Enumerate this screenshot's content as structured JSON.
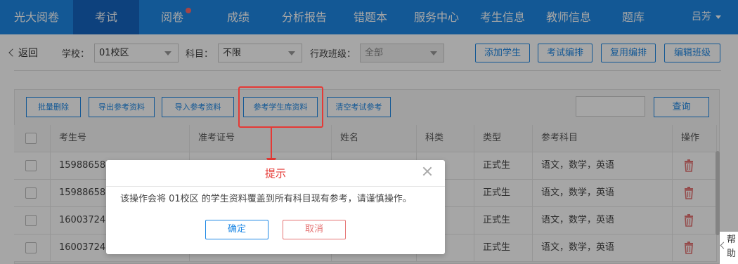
{
  "nav": {
    "brand": "光大阅卷",
    "items": [
      {
        "label": "考试"
      },
      {
        "label": "阅卷"
      },
      {
        "label": "成绩"
      },
      {
        "label": "分析报告"
      },
      {
        "label": "错题本"
      },
      {
        "label": "服务中心"
      },
      {
        "label": "考生信息"
      },
      {
        "label": "教师信息"
      },
      {
        "label": "题库"
      }
    ],
    "user": "吕芳"
  },
  "filters": {
    "back": "返回",
    "school_label": "学校：",
    "school_value": "01校区",
    "subject_label": "科目：",
    "subject_value": "不限",
    "class_label": "行政班级：",
    "class_value": "全部",
    "buttons": [
      "添加学生",
      "考试编排",
      "复用编排",
      "编辑班级"
    ]
  },
  "toolbar": {
    "buttons": [
      "批量删除",
      "导出参考资料",
      "导入参考资料",
      "参考学生库资料",
      "清空考试参考"
    ],
    "search_button": "查询"
  },
  "table": {
    "headers": [
      "考生号",
      "准考证号",
      "姓名",
      "科类",
      "类型",
      "参考科目",
      "操作"
    ],
    "rows": [
      {
        "id": "15988658",
        "type": "正式生",
        "subjects": "语文，数学，英语"
      },
      {
        "id": "15988658",
        "type": "正式生",
        "subjects": "语文，数学，英语"
      },
      {
        "id": "16003724",
        "type": "正式生",
        "subjects": "语文，数学，英语"
      },
      {
        "id": "16003724",
        "type": "正式生",
        "subjects": "语文，数学，英语"
      }
    ]
  },
  "dialog": {
    "title": "提示",
    "message": "该操作会将 01校区 的学生资料覆盖到所有科目现有参考，请谨慎操作。",
    "confirm": "确定",
    "cancel": "取消"
  },
  "help": "帮助",
  "colors": {
    "primary": "#1e88e5",
    "nav_active": "#1565c0",
    "danger": "#e53935"
  }
}
